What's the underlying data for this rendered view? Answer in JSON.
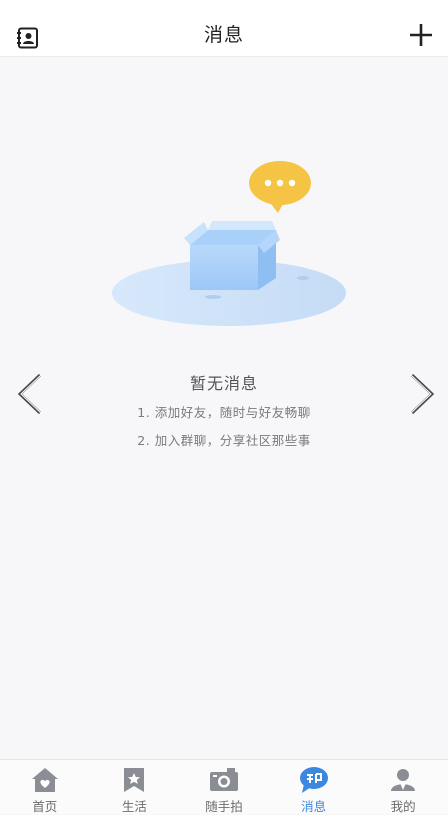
{
  "header": {
    "title": "消息"
  },
  "empty": {
    "title": "暂无消息",
    "hints": [
      "1. 添加好友，随时与好友畅聊",
      "2. 加入群聊，分享社区那些事"
    ]
  },
  "tabs": [
    {
      "label": "首页",
      "icon": "home-icon",
      "active": false
    },
    {
      "label": "生活",
      "icon": "star-bookmark-icon",
      "active": false
    },
    {
      "label": "随手拍",
      "icon": "camera-icon",
      "active": false
    },
    {
      "label": "消息",
      "icon": "chat-icon",
      "active": true
    },
    {
      "label": "我的",
      "icon": "profile-icon",
      "active": false
    }
  ],
  "colors": {
    "accent": "#3c88de",
    "inactive": "#6b6b6b",
    "bubble": "#f6c444"
  }
}
